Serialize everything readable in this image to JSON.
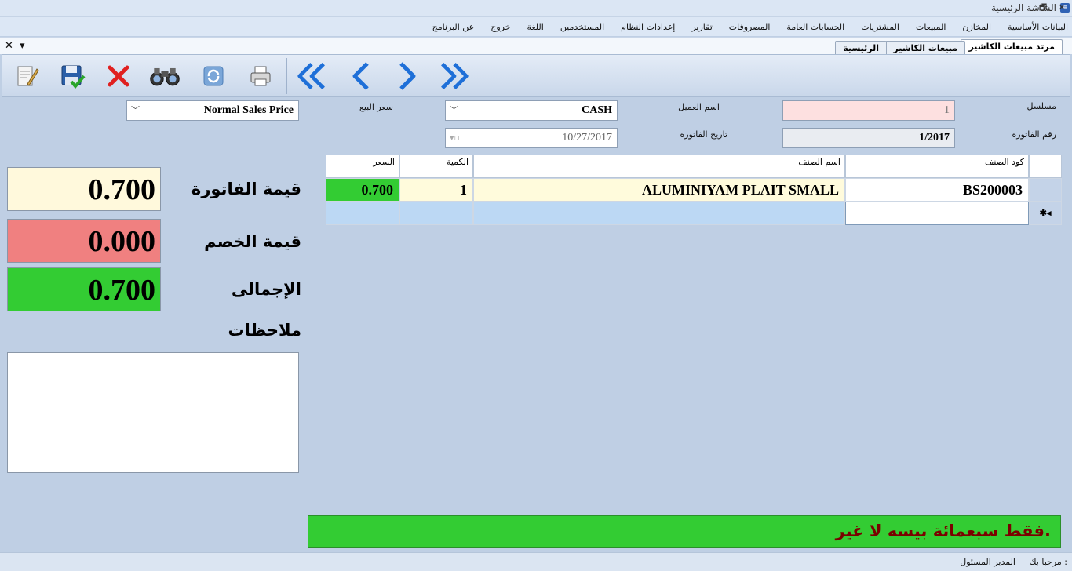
{
  "window": {
    "title": "الشاشة الرئيسية",
    "controls": [
      "🗗",
      "✕"
    ]
  },
  "menu": [
    "البيانات الأساسية",
    "المخازن",
    "المبيعات",
    "المشتريات",
    "الحسابات العامة",
    "المصروفات",
    "تقارير",
    "إعدادات النظام",
    "المستخدمين",
    "اللغة",
    "خروج",
    "عن البرنامج"
  ],
  "tabs": [
    {
      "label": "مرتد مبيعات الكاشير",
      "active": true
    },
    {
      "label": "مبيعات الكاشير",
      "active": false
    },
    {
      "label": "الرئيسية",
      "active": false
    }
  ],
  "tab_controls": {
    "close": "✕",
    "dropdown": "▾"
  },
  "toolbar": {
    "buttons": [
      "new-document-icon",
      "save-icon",
      "delete-icon",
      "search-binoculars-icon",
      "refresh-icon",
      "print-icon"
    ],
    "nav": [
      "first-record-icon",
      "previous-record-icon",
      "next-record-icon",
      "last-record-icon"
    ]
  },
  "form": {
    "serial_label": "مسلسل",
    "serial_value": "1",
    "invoice_no_label": "رقم الفاتورة",
    "invoice_no_value": "1/2017",
    "customer_label": "اسم العميل",
    "customer_value": "CASH",
    "invoice_date_label": "تاريخ الفاتورة",
    "invoice_date_value": "10/27/2017",
    "sale_price_label": "سعر البيع",
    "sale_price_value": "Normal Sales Price"
  },
  "grid": {
    "columns": [
      "كود الصنف",
      "اسم الصنف",
      "الكمية",
      "السعر"
    ],
    "rows": [
      {
        "code": "BS200003",
        "name": "ALUMINIYAM PLAIT SMALL",
        "qty": "1",
        "price": "0.700"
      }
    ],
    "new_row_marker": "✱◂"
  },
  "totals": {
    "invoice_value_label": "قيمة الفاتورة",
    "invoice_value": "0.700",
    "discount_label": "قيمة الخصم",
    "discount_value": "0.000",
    "net_label": "الإجمالى",
    "net_value": "0.700",
    "notes_label": "ملاحظات"
  },
  "message": "فقط سبعمائة بيسه لا غير.",
  "status": {
    "welcome": "مرحبا بك :",
    "user": "المدير المسئول"
  },
  "colors": {
    "invoice_bg": "#fff9dc",
    "discount_bg": "#f08080",
    "net_bg": "#33cc33",
    "serial_bg": "#fde0e0",
    "price_cell_bg": "#33cc33"
  }
}
